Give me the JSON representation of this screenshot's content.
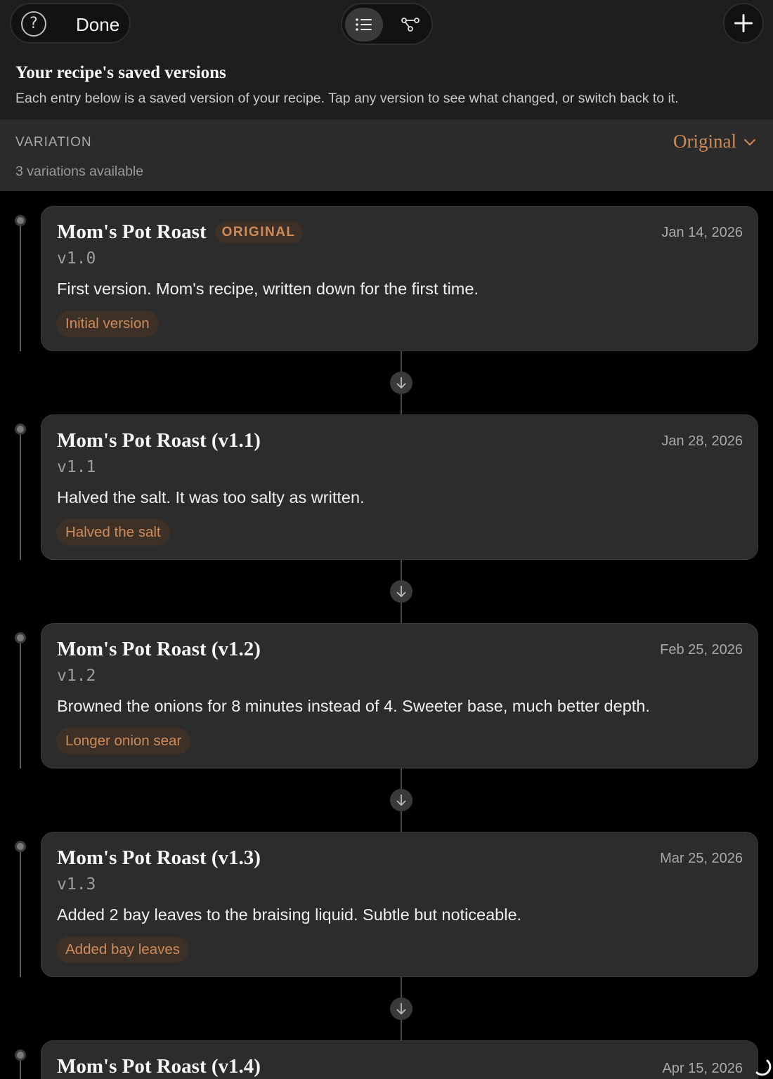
{
  "header": {
    "done_label": "Done",
    "title": "Your recipe's saved versions",
    "subtitle": "Each entry below is a saved version of your recipe. Tap any version to see what changed, or switch back to it."
  },
  "variation": {
    "label": "VARIATION",
    "count_text": "3 variations available",
    "selected": "Original"
  },
  "versions": [
    {
      "title": "Mom's Pot Roast",
      "badge": "ORIGINAL",
      "date": "Jan 14, 2026",
      "version": "v1.0",
      "description": "First version. Mom's recipe, written down for the first time.",
      "tag": "Initial version"
    },
    {
      "title": "Mom's Pot Roast (v1.1)",
      "date": "Jan 28, 2026",
      "version": "v1.1",
      "description": "Halved the salt. It was too salty as written.",
      "tag": "Halved the salt"
    },
    {
      "title": "Mom's Pot Roast (v1.2)",
      "date": "Feb 25, 2026",
      "version": "v1.2",
      "description": "Browned the onions for 8 minutes instead of 4. Sweeter base, much better depth.",
      "tag": "Longer onion sear"
    },
    {
      "title": "Mom's Pot Roast (v1.3)",
      "date": "Mar 25, 2026",
      "version": "v1.3",
      "description": "Added 2 bay leaves to the braising liquid. Subtle but noticeable.",
      "tag": "Added bay leaves"
    },
    {
      "title": "Mom's Pot Roast (v1.4)",
      "date": "Apr 15, 2026"
    }
  ],
  "icons": {
    "help": "help-icon",
    "list_view": "list-view-icon",
    "graph_view": "branch-graph-icon",
    "add": "plus-icon",
    "dropdown": "chevron-down-icon",
    "arrow": "arrow-down-icon",
    "loading": "loading-spinner-icon"
  },
  "colors": {
    "accent": "#cf8a5a",
    "tag_bg": "#3d3027",
    "card_bg": "#2c2c2c",
    "background": "#000000"
  }
}
